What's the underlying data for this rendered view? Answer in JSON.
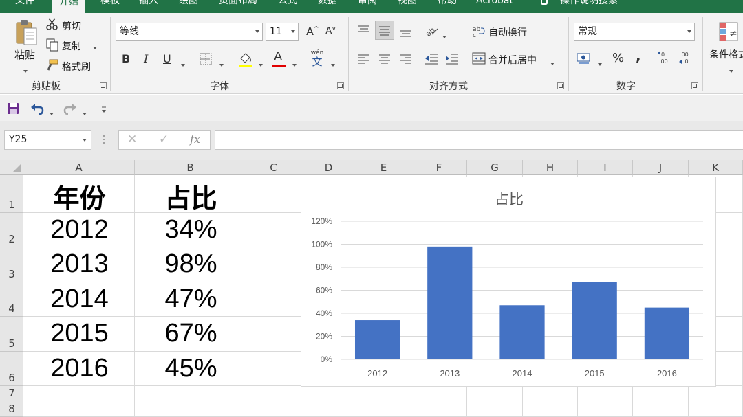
{
  "tabs": [
    {
      "label": "文件",
      "active": false
    },
    {
      "label": "开始",
      "active": true
    },
    {
      "label": "模板",
      "active": false
    },
    {
      "label": "插入",
      "active": false
    },
    {
      "label": "绘图",
      "active": false
    },
    {
      "label": "页面布局",
      "active": false
    },
    {
      "label": "公式",
      "active": false
    },
    {
      "label": "数据",
      "active": false
    },
    {
      "label": "审阅",
      "active": false
    },
    {
      "label": "视图",
      "active": false
    },
    {
      "label": "帮助",
      "active": false
    },
    {
      "label": "Acrobat",
      "active": false
    }
  ],
  "tell_me": "操作说明搜索",
  "ribbon": {
    "clipboard": {
      "paste": "粘贴",
      "cut": "剪切",
      "copy": "复制",
      "format_painter": "格式刷",
      "group_label": "剪贴板"
    },
    "font": {
      "font_name": "等线",
      "font_size": "11",
      "grow": "A",
      "shrink": "A",
      "bold": "B",
      "italic": "I",
      "underline": "U",
      "font_color_letter": "A",
      "phonetic": "wén",
      "phonetic_char": "文",
      "group_label": "字体",
      "fill_color": "#ffff00",
      "font_color": "#e00000"
    },
    "alignment": {
      "wrap_text": "自动换行",
      "merge_center": "合并后居中",
      "group_label": "对齐方式"
    },
    "number": {
      "format": "常规",
      "percent": "%",
      "comma": ",",
      "group_label": "数字"
    },
    "styles": {
      "conditional_format": "条件格式"
    }
  },
  "formula_bar": {
    "name_box": "Y25",
    "cancel": "✕",
    "enter": "✓",
    "fx": "fx",
    "formula": ""
  },
  "columns": [
    "A",
    "B",
    "C",
    "D",
    "E",
    "F",
    "G",
    "H",
    "I",
    "J",
    "K"
  ],
  "rows": [
    "1",
    "2",
    "3",
    "4",
    "5",
    "6",
    "7",
    "8"
  ],
  "cells": {
    "header_year": "年份",
    "header_ratio": "占比",
    "data": [
      {
        "year": "2012",
        "ratio": "34%"
      },
      {
        "year": "2013",
        "ratio": "98%"
      },
      {
        "year": "2014",
        "ratio": "47%"
      },
      {
        "year": "2015",
        "ratio": "67%"
      },
      {
        "year": "2016",
        "ratio": "45%"
      }
    ]
  },
  "chart_data": {
    "type": "bar",
    "title": "占比",
    "categories": [
      "2012",
      "2013",
      "2014",
      "2015",
      "2016"
    ],
    "values": [
      0.34,
      0.98,
      0.47,
      0.67,
      0.45
    ],
    "ylim": [
      0,
      1.2
    ],
    "yticks": [
      0,
      0.2,
      0.4,
      0.6,
      0.8,
      1.0,
      1.2
    ],
    "ytick_labels": [
      "0%",
      "20%",
      "40%",
      "60%",
      "80%",
      "100%",
      "120%"
    ],
    "grid": true,
    "bar_color": "#4472c4",
    "xlabel": "",
    "ylabel": ""
  },
  "colors": {
    "accent": "#217346",
    "save_icon": "#6b2d8f",
    "undo_icon": "#2b579a"
  }
}
